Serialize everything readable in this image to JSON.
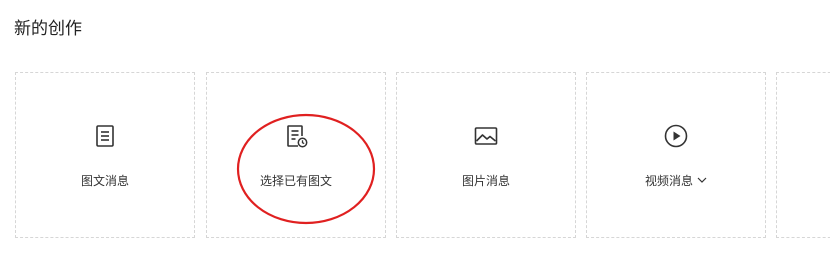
{
  "section": {
    "title": "新的创作"
  },
  "cards": [
    {
      "label": "图文消息",
      "icon": "document-icon"
    },
    {
      "label": "选择已有图文",
      "icon": "document-clock-icon"
    },
    {
      "label": "图片消息",
      "icon": "image-icon"
    },
    {
      "label": "视频消息",
      "icon": "play-circle-icon",
      "has_dropdown": true
    }
  ],
  "colors": {
    "border": "#d6d6d6",
    "icon": "#333333",
    "annotation": "#e02020"
  }
}
